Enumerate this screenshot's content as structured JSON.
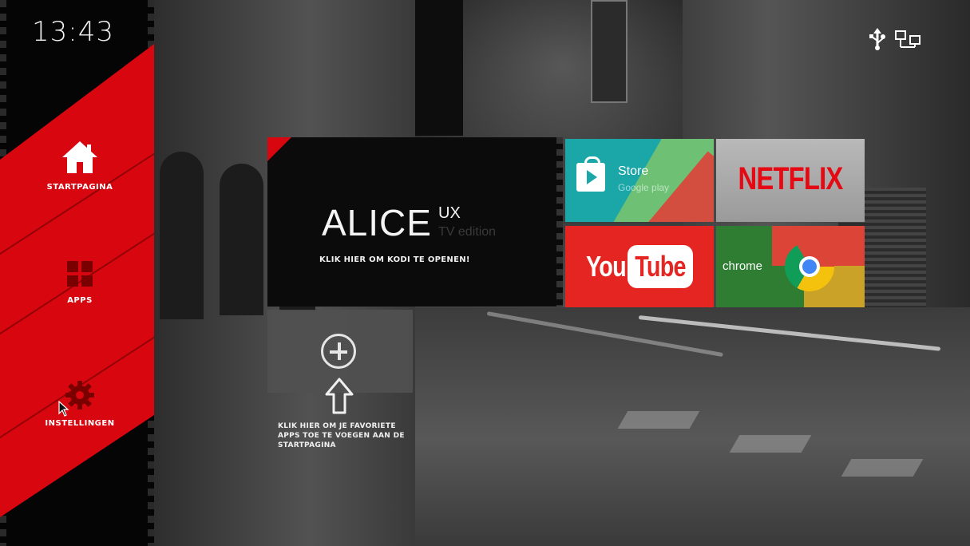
{
  "status_bar": {
    "time": "13:43",
    "icons": [
      "usb-icon",
      "ethernet-icon"
    ]
  },
  "sidebar": {
    "items": [
      {
        "label": "Startpagina",
        "icon": "home-icon"
      },
      {
        "label": "Apps",
        "icon": "apps-grid-icon"
      },
      {
        "label": "Instellingen",
        "icon": "gear-icon"
      }
    ]
  },
  "launcher": {
    "logo_main": "ALICE",
    "logo_sup": "UX",
    "logo_edition": "TV edition",
    "subtitle": "Klik hier om Kodi te openen!"
  },
  "apps": {
    "store": {
      "title": "Store",
      "subtitle": "Google play"
    },
    "netflix": {
      "title": "NETFLIX"
    },
    "youtube": {
      "you": "You",
      "tube": "Tube"
    },
    "chrome": {
      "title": "chrome"
    }
  },
  "favorites_hint": "Klik hier om je favoriete apps toe te voegen aan de startpagina",
  "colors": {
    "accent": "#d8060f",
    "netflix_red": "#e50914",
    "youtube_red": "#e52521",
    "store_teal": "#1ba6a8"
  }
}
